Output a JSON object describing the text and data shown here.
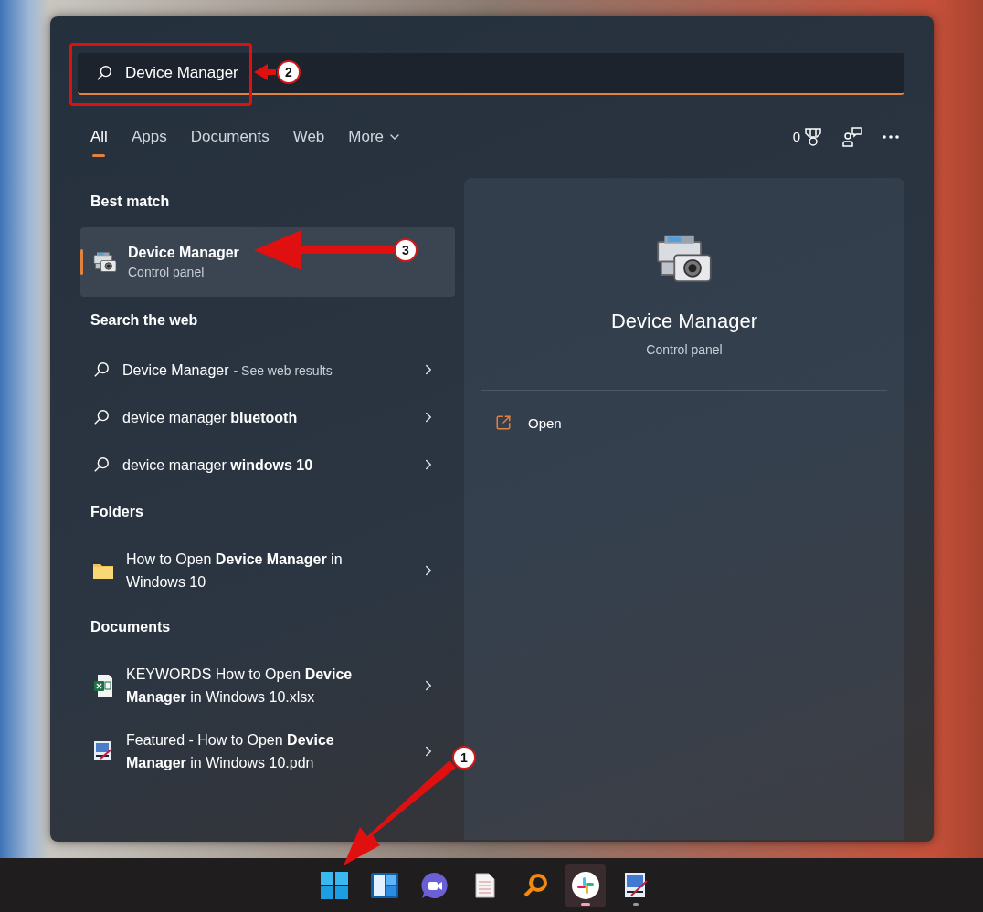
{
  "search": {
    "value": "Device Manager"
  },
  "tabs": [
    {
      "label": "All",
      "selected": true
    },
    {
      "label": "Apps",
      "selected": false
    },
    {
      "label": "Documents",
      "selected": false
    },
    {
      "label": "Web",
      "selected": false
    },
    {
      "label": "More",
      "selected": false,
      "dropdown": true
    }
  ],
  "toolbar": {
    "points": "0"
  },
  "best_match": {
    "heading": "Best match",
    "item": {
      "title": "Device Manager",
      "subtitle": "Control panel",
      "selected": true
    }
  },
  "web": {
    "heading": "Search the web",
    "items": [
      {
        "text": "Device Manager",
        "suffix": "- See web results"
      },
      {
        "text": "device manager **bluetooth**"
      },
      {
        "text": "device manager **windows 10**"
      }
    ]
  },
  "folders": {
    "heading": "Folders",
    "items": [
      {
        "kind": "folder",
        "text": "How to Open **Device Manager** in Windows 10"
      }
    ]
  },
  "documents": {
    "heading": "Documents",
    "items": [
      {
        "kind": "spreadsheet",
        "text": "KEYWORDS How to Open **Device Manager** in Windows 10.xlsx"
      },
      {
        "kind": "image",
        "text": "Featured - How to Open **Device Manager** in Windows 10.pdn"
      }
    ]
  },
  "preview": {
    "title": "Device Manager",
    "subtitle": "Control panel",
    "actions": [
      {
        "label": "Open"
      }
    ]
  },
  "taskbar": [
    {
      "kind": "start",
      "running": false,
      "focused": false
    },
    {
      "kind": "widgets",
      "running": false,
      "focused": false
    },
    {
      "kind": "chat",
      "running": false,
      "focused": false
    },
    {
      "kind": "notepad",
      "running": false,
      "focused": false
    },
    {
      "kind": "search",
      "running": false,
      "focused": false
    },
    {
      "kind": "slack",
      "running": true,
      "focused": true
    },
    {
      "kind": "paint",
      "running": true,
      "focused": false
    }
  ],
  "callouts": [
    {
      "number": "1"
    },
    {
      "number": "2"
    },
    {
      "number": "3"
    }
  ]
}
